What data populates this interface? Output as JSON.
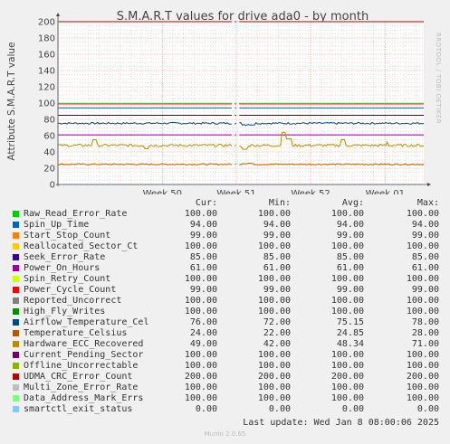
{
  "title": "S.M.A.R.T values for drive ada0 - by month",
  "ylabel": "Attribute S.M.A.R.T value",
  "credit": "RRDTOOL / TOBI OETIKER",
  "legend_headers": {
    "cur": "Cur:",
    "min": "Min:",
    "avg": "Avg:",
    "max": "Max:"
  },
  "chart_data": {
    "type": "line",
    "title": "S.M.A.R.T values for drive ada0 - by month",
    "ylabel": "Attribute S.M.A.R.T value",
    "ylim": [
      0,
      200
    ],
    "yticks": [
      0,
      20,
      40,
      60,
      80,
      100,
      120,
      140,
      160,
      180,
      200
    ],
    "x_ticks": [
      "Week 50",
      "Week 51",
      "Week 52",
      "Week 01"
    ],
    "grid": true,
    "series": [
      {
        "name": "Raw_Read_Error_Rate",
        "color": "#00cc00",
        "cur": "100.00",
        "min": "100.00",
        "avg": "100.00",
        "max": "100.00",
        "level": 100
      },
      {
        "name": "Spin_Up_Time",
        "color": "#0066b3",
        "cur": "94.00",
        "min": "94.00",
        "avg": "94.00",
        "max": "94.00",
        "level": 94
      },
      {
        "name": "Start_Stop_Count",
        "color": "#ff8000",
        "cur": "99.00",
        "min": "99.00",
        "avg": "99.00",
        "max": "99.00",
        "level": 99
      },
      {
        "name": "Reallocated_Sector_Ct",
        "color": "#ffcc00",
        "cur": "100.00",
        "min": "100.00",
        "avg": "100.00",
        "max": "100.00",
        "level": 100
      },
      {
        "name": "Seek_Error_Rate",
        "color": "#330099",
        "cur": "85.00",
        "min": "85.00",
        "avg": "85.00",
        "max": "85.00",
        "level": 85
      },
      {
        "name": "Power_On_Hours",
        "color": "#990099",
        "cur": "61.00",
        "min": "61.00",
        "avg": "61.00",
        "max": "61.00",
        "level": 61
      },
      {
        "name": "Spin_Retry_Count",
        "color": "#ccff00",
        "cur": "100.00",
        "min": "100.00",
        "avg": "100.00",
        "max": "100.00",
        "level": 100
      },
      {
        "name": "Power_Cycle_Count",
        "color": "#ff0000",
        "cur": "99.00",
        "min": "99.00",
        "avg": "99.00",
        "max": "99.00",
        "level": 99
      },
      {
        "name": "Reported_Uncorrect",
        "color": "#808080",
        "cur": "100.00",
        "min": "100.00",
        "avg": "100.00",
        "max": "100.00",
        "level": 100
      },
      {
        "name": "High_Fly_Writes",
        "color": "#008f00",
        "cur": "100.00",
        "min": "100.00",
        "avg": "100.00",
        "max": "100.00",
        "level": 100
      },
      {
        "name": "Airflow_Temperature_Cel",
        "color": "#00487d",
        "cur": "76.00",
        "min": "72.00",
        "avg": "75.15",
        "max": "78.00",
        "level": 76,
        "noise": "airflow"
      },
      {
        "name": "Temperature_Celsius",
        "color": "#b35a00",
        "cur": "24.00",
        "min": "22.00",
        "avg": "24.85",
        "max": "28.00",
        "level": 25,
        "noise": "temp"
      },
      {
        "name": "Hardware_ECC_Recovered",
        "color": "#b38f00",
        "cur": "49.00",
        "min": "42.00",
        "avg": "48.34",
        "max": "71.00",
        "level": 48,
        "noise": "ecc"
      },
      {
        "name": "Current_Pending_Sector",
        "color": "#6b006b",
        "cur": "100.00",
        "min": "100.00",
        "avg": "100.00",
        "max": "100.00",
        "level": 100
      },
      {
        "name": "Offline_Uncorrectable",
        "color": "#8fb300",
        "cur": "100.00",
        "min": "100.00",
        "avg": "100.00",
        "max": "100.00",
        "level": 100
      },
      {
        "name": "UDMA_CRC_Error_Count",
        "color": "#b30000",
        "cur": "200.00",
        "min": "200.00",
        "avg": "200.00",
        "max": "200.00",
        "level": 200
      },
      {
        "name": "Multi_Zone_Error_Rate",
        "color": "#bebebe",
        "cur": "100.00",
        "min": "100.00",
        "avg": "100.00",
        "max": "100.00",
        "level": 100
      },
      {
        "name": "Data_Address_Mark_Errs",
        "color": "#80ff80",
        "cur": "100.00",
        "min": "100.00",
        "avg": "100.00",
        "max": "100.00",
        "level": 100
      },
      {
        "name": "smartctl_exit_status",
        "color": "#80c9ff",
        "cur": "0.00",
        "min": "0.00",
        "avg": "0.00",
        "max": "0.00",
        "level": 0
      }
    ]
  },
  "last_update": "Last update: Wed Jan  8 08:00:06 2025",
  "munin_version": "Munin 2.0.65"
}
